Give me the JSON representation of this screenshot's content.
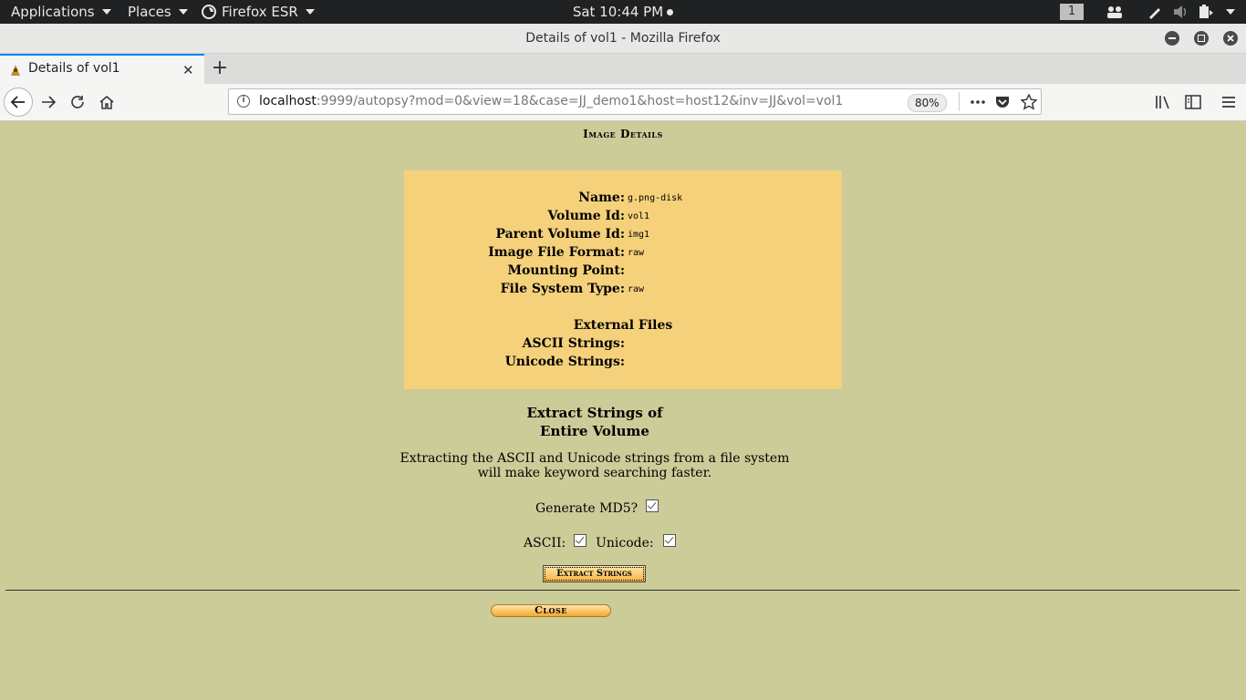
{
  "topbar": {
    "applications": "Applications",
    "places": "Places",
    "browser_menu": "Firefox ESR",
    "clock": "Sat 10:44 PM",
    "workspace": "1"
  },
  "window": {
    "title": "Details of vol1 - Mozilla Firefox"
  },
  "tab": {
    "label": "Details of vol1"
  },
  "navbar": {
    "url_host": "localhost",
    "url_rest": ":9999/autopsy?mod=0&view=18&case=JJ_demo1&host=host12&inv=JJ&vol=vol1",
    "zoom": "80%"
  },
  "page": {
    "heading": "Image Details",
    "details": [
      {
        "key": "Name:",
        "value": "g.png-disk"
      },
      {
        "key": "Volume Id:",
        "value": "vol1"
      },
      {
        "key": "Parent Volume Id:",
        "value": "img1"
      },
      {
        "key": "Image File Format:",
        "value": "raw"
      },
      {
        "key": "Mounting Point:",
        "value": ""
      },
      {
        "key": "File System Type:",
        "value": "raw"
      }
    ],
    "external_files": "External Files",
    "ascii_strings": "ASCII Strings:",
    "unicode_strings": "Unicode Strings:",
    "extract_title_1": "Extract Strings of",
    "extract_title_2": "Entire Volume",
    "extract_desc_1": "Extracting the ASCII and Unicode strings from a file system",
    "extract_desc_2": "will make keyword searching faster.",
    "md5_label": "Generate MD5?",
    "ascii_label": "ASCII:",
    "unicode_label": "Unicode:",
    "md5_checked": true,
    "ascii_checked": true,
    "unicode_checked": true,
    "extract_button": "Extract Strings",
    "close_button": "Close"
  }
}
